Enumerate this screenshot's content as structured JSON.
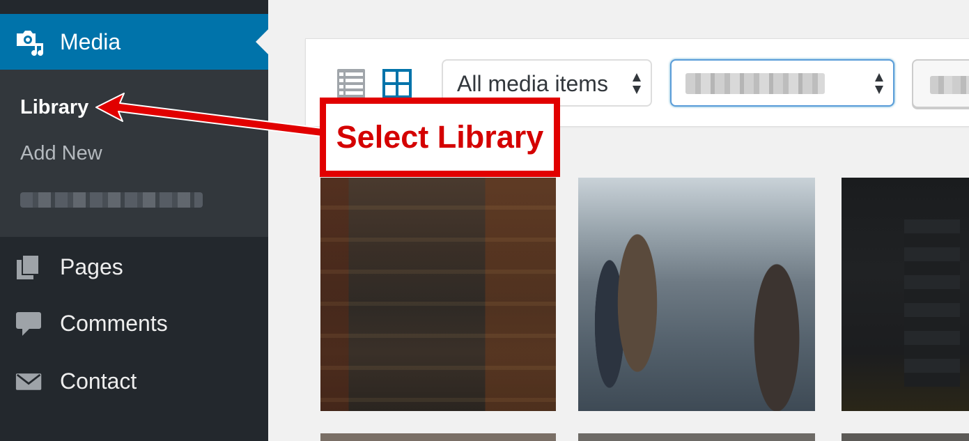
{
  "sidebar": {
    "media": {
      "label": "Media",
      "icon": "media-icon"
    },
    "submenu": {
      "library": "Library",
      "add_new": "Add New",
      "blurred_item": ""
    },
    "items": [
      {
        "label": "Pages",
        "icon": "pages-icon"
      },
      {
        "label": "Comments",
        "icon": "comments-icon"
      },
      {
        "label": "Contact",
        "icon": "envelope-icon"
      }
    ]
  },
  "toolbar": {
    "type_filter": {
      "selected": "All media items"
    },
    "date_filter": {
      "selected": ""
    },
    "bulk_button": {
      "label": ""
    },
    "views": [
      "list-view-icon",
      "grid-view-icon"
    ]
  },
  "annotation": {
    "text": "Select Library",
    "color": "#e10000"
  },
  "colors": {
    "sidebar_bg": "#23282d",
    "submenu_bg": "#32373c",
    "active_menu": "#0073aa",
    "focus_border": "#5b9dd9"
  },
  "thumbnails": [
    {
      "id": "thumb-1"
    },
    {
      "id": "thumb-2"
    },
    {
      "id": "thumb-3"
    },
    {
      "id": "thumb-4"
    },
    {
      "id": "thumb-5"
    },
    {
      "id": "thumb-6"
    }
  ]
}
